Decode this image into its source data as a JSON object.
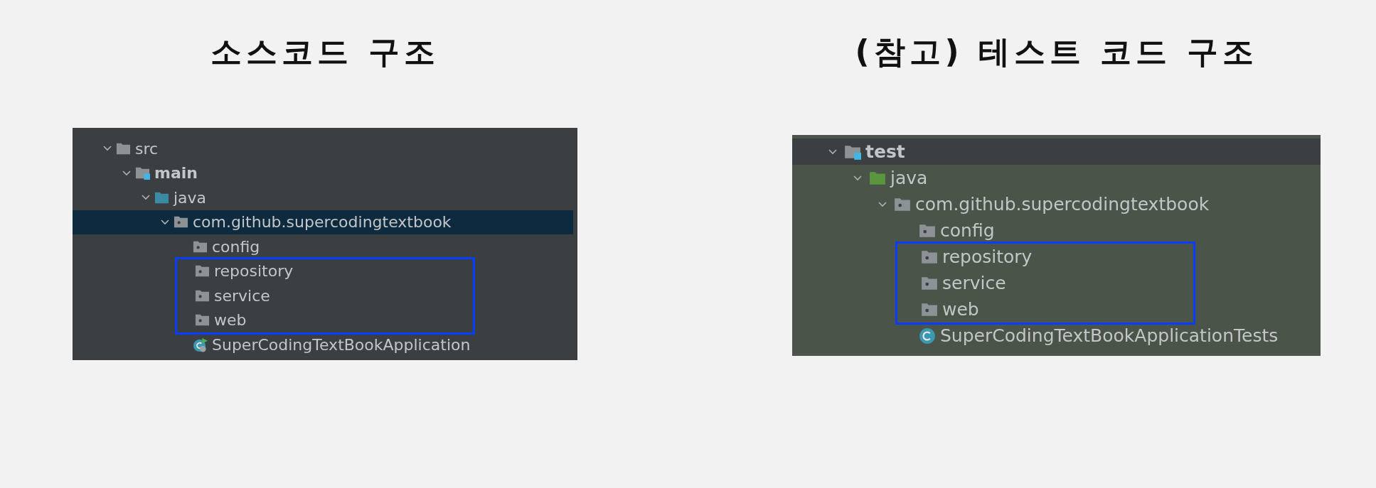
{
  "panels": [
    {
      "title": "소스코드 구조",
      "tree": [
        {
          "label": "src",
          "kind": "folder",
          "selected": false,
          "expanded": true,
          "children": [
            {
              "label": "main",
              "kind": "module",
              "selected": false,
              "expanded": true,
              "children": [
                {
                  "label": "java",
                  "kind": "source_root",
                  "selected": false,
                  "expanded": true,
                  "children": [
                    {
                      "label": "com.github.supercodingtextbook",
                      "kind": "package",
                      "selected": true,
                      "expanded": true,
                      "children": [
                        {
                          "label": "config",
                          "kind": "package",
                          "selected": false,
                          "boxed": false
                        },
                        {
                          "label": "repository",
                          "kind": "package",
                          "selected": false,
                          "boxed": true
                        },
                        {
                          "label": "service",
                          "kind": "package",
                          "selected": false,
                          "boxed": true
                        },
                        {
                          "label": "web",
                          "kind": "package",
                          "selected": false,
                          "boxed": true
                        },
                        {
                          "label": "SuperCodingTextBookApplication",
                          "kind": "app_class",
                          "selected": false,
                          "boxed": false
                        }
                      ]
                    }
                  ]
                }
              ]
            }
          ]
        }
      ]
    },
    {
      "title": "(참고) 테스트 코드 구조",
      "tree": [
        {
          "label": "test",
          "kind": "module",
          "selected": false,
          "test_scope": false,
          "expanded": true,
          "children": [
            {
              "label": "java",
              "kind": "test_root",
              "selected": false,
              "test_scope": true,
              "expanded": true,
              "children": [
                {
                  "label": "com.github.supercodingtextbook",
                  "kind": "package",
                  "selected": false,
                  "test_scope": true,
                  "expanded": true,
                  "children": [
                    {
                      "label": "config",
                      "kind": "package",
                      "selected": false,
                      "test_scope": true,
                      "boxed": false
                    },
                    {
                      "label": "repository",
                      "kind": "package",
                      "selected": false,
                      "test_scope": true,
                      "boxed": true
                    },
                    {
                      "label": "service",
                      "kind": "package",
                      "selected": false,
                      "test_scope": true,
                      "boxed": true
                    },
                    {
                      "label": "web",
                      "kind": "package",
                      "selected": false,
                      "test_scope": true,
                      "boxed": true
                    },
                    {
                      "label": "SuperCodingTextBookApplicationTests",
                      "kind": "class",
                      "selected": false,
                      "test_scope": true,
                      "boxed": false
                    }
                  ]
                }
              ]
            }
          ]
        }
      ]
    }
  ]
}
